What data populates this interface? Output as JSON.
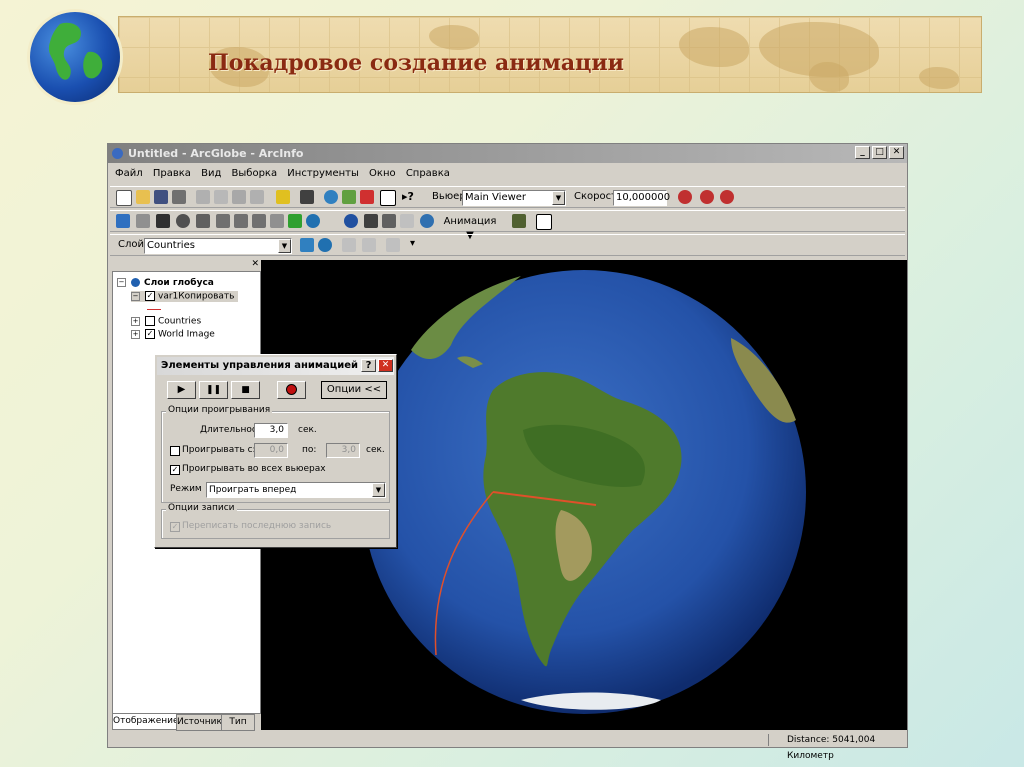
{
  "slide": {
    "title": "Покадровое создание анимации"
  },
  "window": {
    "title": "Untitled - ArcGlobe - ArcInfo",
    "menu": [
      "Файл",
      "Правка",
      "Вид",
      "Выборка",
      "Инструменты",
      "Окно",
      "Справка"
    ],
    "toolbar1": {
      "viewer_label": "Вьюер:",
      "viewer_value": "Main Viewer",
      "speed_label": "Скорость:",
      "speed_value": "10,000000"
    },
    "toolbar2": {
      "animation_label": "Анимация"
    },
    "toolbar3": {
      "layer_label": "Слой:",
      "layer_value": "Countries"
    },
    "toc": {
      "root": "Слои глобуса",
      "items": [
        "var1Копировать",
        "Countries",
        "World Image"
      ],
      "tabs": [
        "Отображение",
        "Источник",
        "Тип"
      ]
    },
    "status": {
      "distance": "Distance:  5041,004 Километр"
    }
  },
  "dialog": {
    "title": "Элементы управления анимацией",
    "help": "?",
    "options_button": "Опции <<",
    "playback_group": "Опции проигрывания",
    "duration_label": "Длительность:",
    "duration_value": "3,0",
    "sec": "сек.",
    "play_from_label": "Проигрывать с:",
    "from_value": "0,0",
    "to_label": "по:",
    "to_value": "3,0",
    "play_all_label": "Проигрывать во всех вьюерах",
    "mode_label": "Режим",
    "mode_value": "Проиграть вперед",
    "record_group": "Опции записи",
    "overwrite_label": "Переписать последнюю запись"
  }
}
